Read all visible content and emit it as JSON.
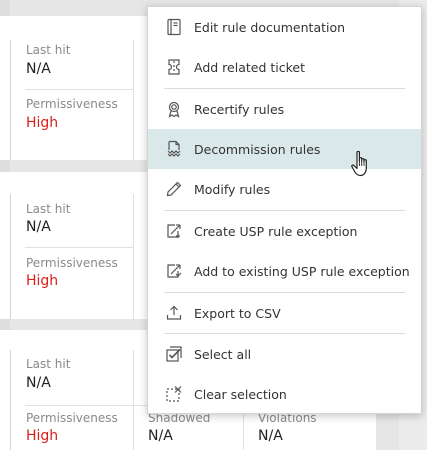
{
  "cards": [
    {
      "last_hit_label": "Last hit",
      "last_hit_value": "N/A",
      "permissiveness_label": "Permissiveness",
      "permissiveness_value": "High"
    },
    {
      "last_hit_label": "Last hit",
      "last_hit_value": "N/A",
      "permissiveness_label": "Permissiveness",
      "permissiveness_value": "High"
    },
    {
      "last_hit_label": "Last hit",
      "last_hit_value": "N/A",
      "permissiveness_label": "Permissiveness",
      "permissiveness_value": "High",
      "shadowed_label": "Shadowed",
      "shadowed_value": "N/A",
      "violations_label": "Violations",
      "violations_value": "N/A"
    }
  ],
  "menu": {
    "items": [
      {
        "label": "Edit rule documentation",
        "icon": "document-icon"
      },
      {
        "label": "Add related ticket",
        "icon": "ticket-icon"
      },
      {
        "label": "Recertify rules",
        "icon": "ribbon-icon"
      },
      {
        "label": "Decommission rules",
        "icon": "decommission-document-icon"
      },
      {
        "label": "Modify rules",
        "icon": "pencil-icon"
      },
      {
        "label": "Create USP rule exception",
        "icon": "create-exception-icon"
      },
      {
        "label": "Add to existing USP rule exception",
        "icon": "add-exception-icon"
      },
      {
        "label": "Export to CSV",
        "icon": "export-icon"
      },
      {
        "label": "Select all",
        "icon": "select-all-icon"
      },
      {
        "label": "Clear selection",
        "icon": "clear-selection-icon"
      }
    ]
  },
  "colors": {
    "danger": "#d9201a",
    "hover": "#dbe8ea"
  }
}
